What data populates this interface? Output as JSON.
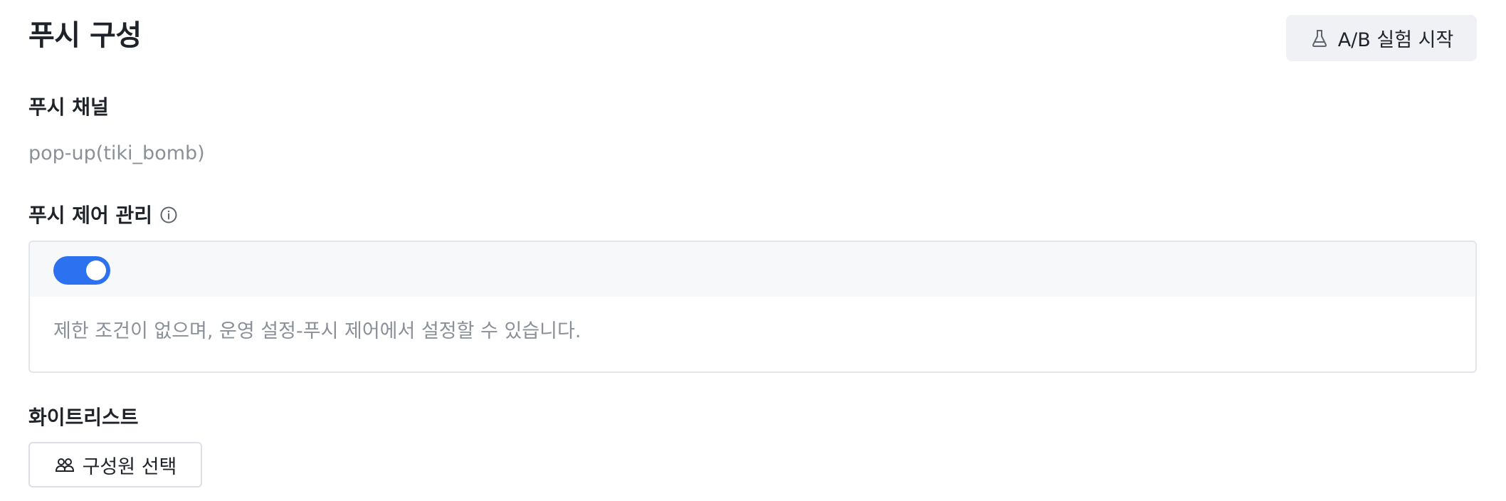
{
  "header": {
    "title": "푸시 구성",
    "ab_button_label": "A/B 실험 시작",
    "ab_button_icon": "flask-icon"
  },
  "push_channel": {
    "label": "푸시 채널",
    "value": "pop-up(tiki_bomb)"
  },
  "push_control": {
    "label": "푸시 제어 관리",
    "info_icon": "info-icon",
    "toggle_on": true,
    "description": "제한 조건이 없으며, 운영 설정-푸시 제어에서 설정할 수 있습니다."
  },
  "whitelist": {
    "label": "화이트리스트",
    "button_label": "구성원 선택",
    "button_icon": "users-icon"
  },
  "colors": {
    "accent": "#2b71f0",
    "text_primary": "#1f2329",
    "text_secondary": "#8a8f98",
    "panel_bg": "#f7f8fa",
    "border": "#e3e5ea"
  }
}
